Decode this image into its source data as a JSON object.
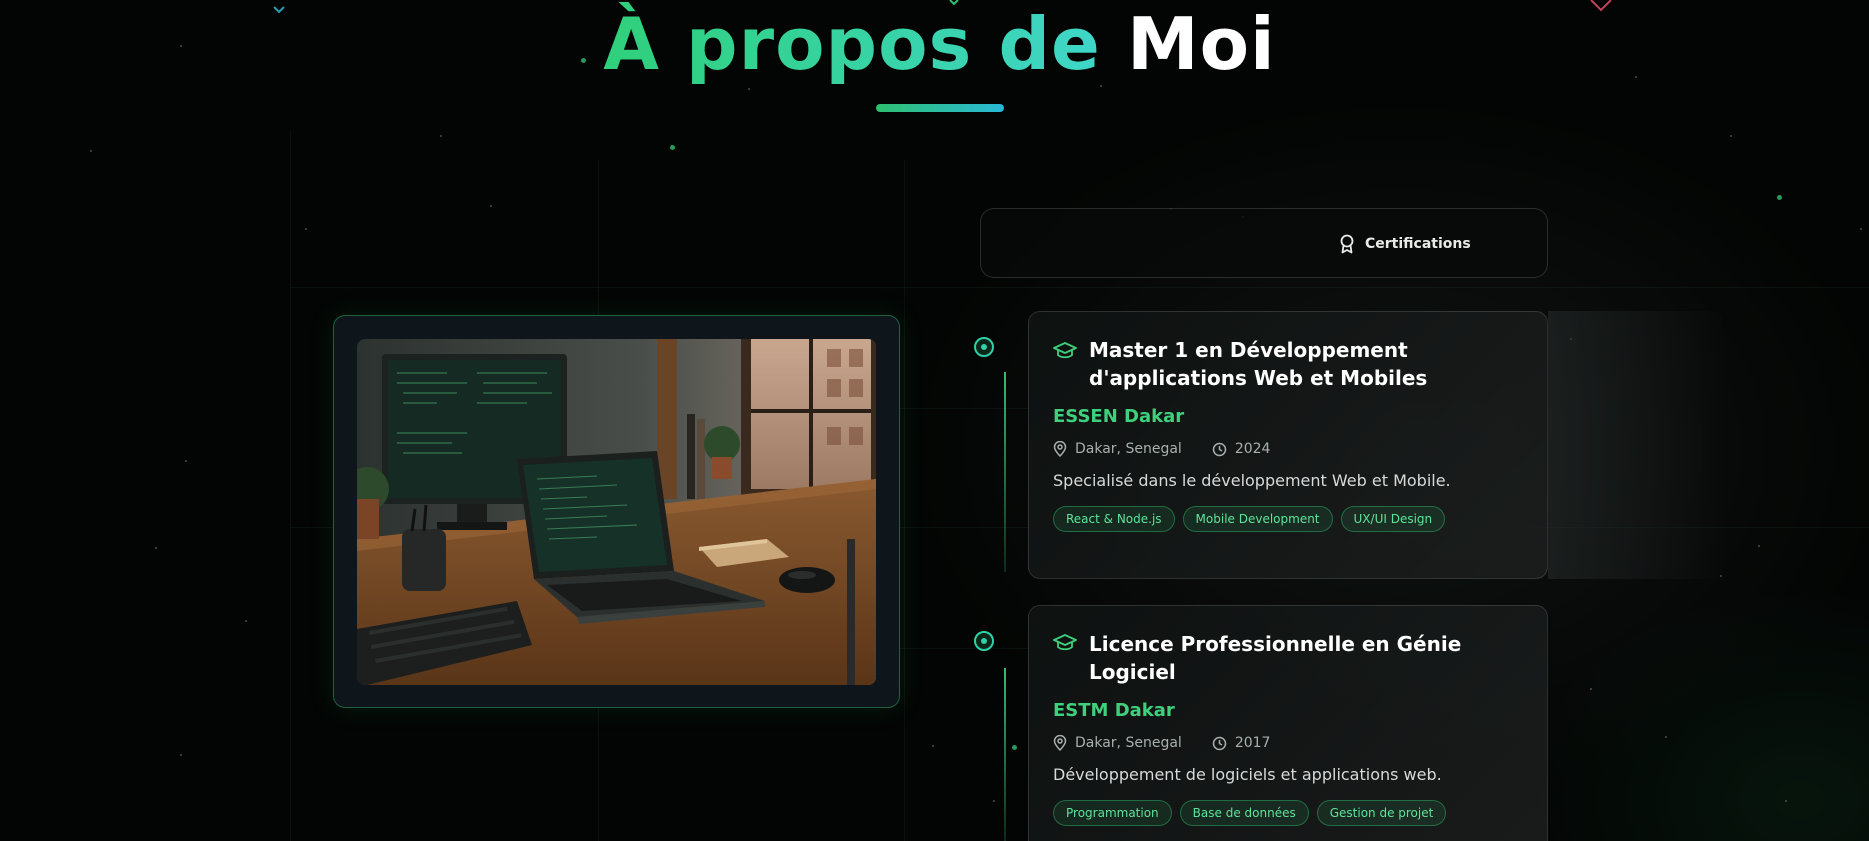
{
  "title": {
    "accent": "À propos de",
    "main": "Moi"
  },
  "tabs": [
    {
      "label": "Certifications",
      "icon": "award-icon"
    }
  ],
  "education": [
    {
      "title": "Master 1 en Développement d'applications Web et Mobiles",
      "school": "ESSEN Dakar",
      "location": "Dakar, Senegal",
      "year": "2024",
      "description": "Specialisé dans le développement Web et Mobile.",
      "tags": [
        "React & Node.js",
        "Mobile Development",
        "UX/UI Design"
      ]
    },
    {
      "title": "Licence Professionnelle en Génie Logiciel",
      "school": "ESTM Dakar",
      "location": "Dakar, Senegal",
      "year": "2017",
      "description": "Développement de logiciels et applications web.",
      "tags": [
        "Programmation",
        "Base de données",
        "Gestion de projet"
      ]
    }
  ],
  "colors": {
    "accent": "#2fbf71",
    "accent_alt": "#29b9d6",
    "background": "#030504"
  },
  "icons": {
    "school": "graduation-cap-icon",
    "location": "map-pin-icon",
    "year": "clock-icon"
  }
}
